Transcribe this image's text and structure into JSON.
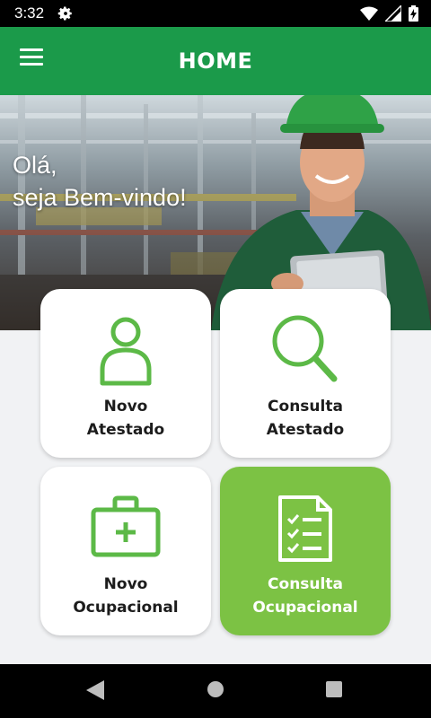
{
  "status_bar": {
    "time": "3:32"
  },
  "app_bar": {
    "title": "HOME"
  },
  "hero": {
    "greeting_line1": "Olá,",
    "greeting_line2": "seja Bem-vindo!"
  },
  "cards": [
    {
      "line1": "Novo",
      "line2": "Atestado",
      "icon": "person-icon"
    },
    {
      "line1": "Consulta",
      "line2": "Atestado",
      "icon": "search-icon"
    },
    {
      "line1": "Novo",
      "line2": "Ocupacional",
      "icon": "medical-kit-icon"
    },
    {
      "line1": "Consulta",
      "line2": "Ocupacional",
      "icon": "checklist-document-icon",
      "selected": true
    }
  ],
  "colors": {
    "app_bar": "#1b9a4a",
    "accent": "#7cc244",
    "icon_green": "#5cb947"
  }
}
